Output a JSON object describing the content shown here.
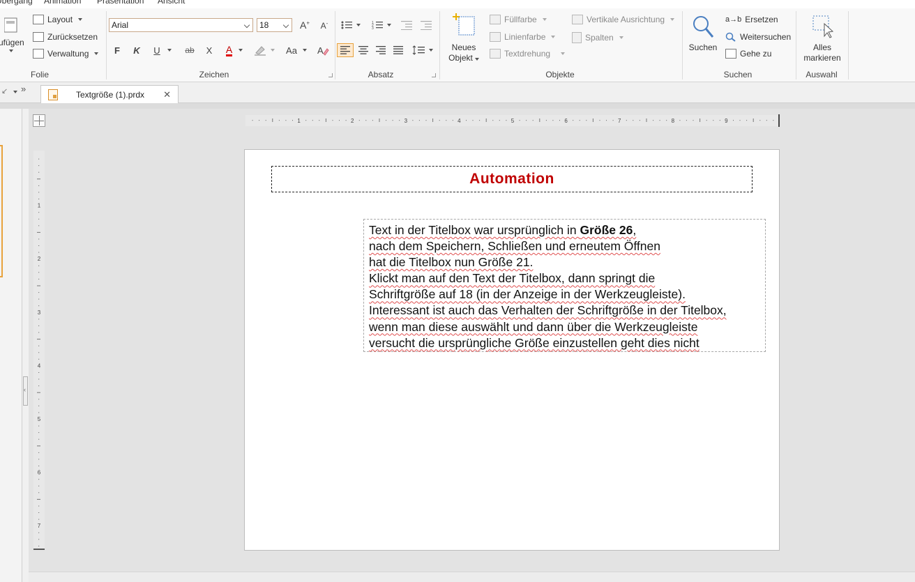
{
  "menu": {
    "items": [
      "Übergang",
      "Animation",
      "Präsentation",
      "Ansicht"
    ]
  },
  "ribbon": {
    "folie": {
      "label": "Folie",
      "insert_partial": "ufügen",
      "layout": "Layout",
      "reset": "Zurücksetzen",
      "manage": "Verwaltung"
    },
    "zeichen": {
      "label": "Zeichen",
      "font": "Arial",
      "size": "18",
      "bold": "F",
      "italic": "K",
      "underline": "U",
      "strike": "ab",
      "clear": "X",
      "color": "A",
      "case": "Aa"
    },
    "absatz": {
      "label": "Absatz"
    },
    "objekte": {
      "label": "Objekte",
      "new_object": "Neues",
      "new_object_2": "Objekt",
      "fill": "Füllfarbe",
      "line": "Linienfarbe",
      "rotate": "Textdrehung",
      "valign": "Vertikale Ausrichtung",
      "columns": "Spalten"
    },
    "suchen": {
      "label": "Suchen",
      "search": "Suchen",
      "replace": "Ersetzen",
      "replace_prefix": "a→b",
      "continue": "Weitersuchen",
      "goto": "Gehe zu"
    },
    "auswahl": {
      "label": "Auswahl",
      "select_all": "Alles",
      "select_all_2": "markieren"
    }
  },
  "tab": {
    "title": "Textgröße (1).prdx",
    "close": "✕"
  },
  "slide": {
    "title": "Automation",
    "body_lines": [
      "nach dem Speichern, Schließen und erneutem Öffnen",
      "hat die Titelbox nun Größe 21.",
      "Klickt man auf den Text der Titelbox, dann springt die",
      "Schriftgröße auf 18 (in der Anzeige in der Werkzeugleiste).",
      "Interessant ist auch das Verhalten der Schriftgröße in der Titelbox,",
      "wenn man diese auswählt und dann über die Werkzeugleiste",
      "versucht die ursprüngliche Größe einzustellen geht dies nicht"
    ],
    "line1_prefix": "Text in der Titelbox war ursprünglich in ",
    "line1_bold": "Größe 26",
    "line1_suffix": ","
  },
  "rulers": {
    "h_labels": [
      "1",
      "2",
      "3",
      "4",
      "5",
      "6",
      "7",
      "8",
      "9"
    ],
    "v_labels": [
      "1",
      "2",
      "3",
      "4",
      "5",
      "6",
      "7"
    ]
  },
  "colors": {
    "title_red": "#c00000",
    "accent_orange": "#e8a23c"
  }
}
